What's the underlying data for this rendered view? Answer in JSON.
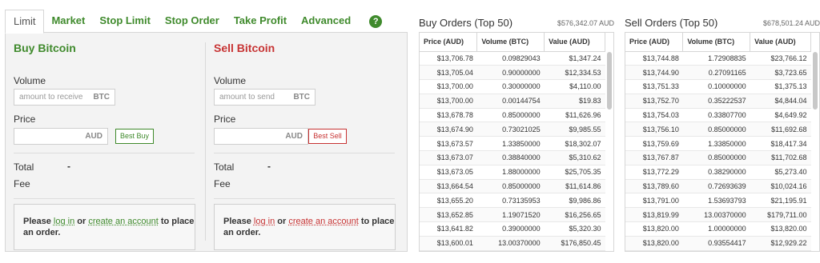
{
  "tabs": [
    "Limit",
    "Market",
    "Stop Limit",
    "Stop Order",
    "Take Profit",
    "Advanced"
  ],
  "help_icon": "question-circle-icon",
  "colors": {
    "buy": "#3f8a2c",
    "sell": "#c73333"
  },
  "buy": {
    "title": "Buy Bitcoin",
    "volume_label": "Volume",
    "volume_placeholder": "amount to receive",
    "volume_unit": "BTC",
    "price_label": "Price",
    "price_unit": "AUD",
    "best_button": "Best Buy",
    "total_label": "Total",
    "total_value": "-",
    "fee_label": "Fee",
    "login_prefix": "Please ",
    "login_link": "log in",
    "login_or": " or ",
    "create_link": "create an account",
    "login_suffix": " to place an order."
  },
  "sell": {
    "title": "Sell Bitcoin",
    "volume_label": "Volume",
    "volume_placeholder": "amount to send",
    "volume_unit": "BTC",
    "price_label": "Price",
    "price_unit": "AUD",
    "best_button": "Best Sell",
    "total_label": "Total",
    "total_value": "-",
    "fee_label": "Fee",
    "login_prefix": "Please ",
    "login_link": "log in",
    "login_or": " or ",
    "create_link": "create an account",
    "login_suffix": " to place an order."
  },
  "buy_orders": {
    "title": "Buy Orders (Top 50)",
    "total": "$576,342.07 AUD",
    "columns": [
      "Price (AUD)",
      "Volume (BTC)",
      "Value (AUD)"
    ],
    "rows": [
      [
        "$13,706.78",
        "0.09829043",
        "$1,347.24"
      ],
      [
        "$13,705.04",
        "0.90000000",
        "$12,334.53"
      ],
      [
        "$13,700.00",
        "0.30000000",
        "$4,110.00"
      ],
      [
        "$13,700.00",
        "0.00144754",
        "$19.83"
      ],
      [
        "$13,678.78",
        "0.85000000",
        "$11,626.96"
      ],
      [
        "$13,674.90",
        "0.73021025",
        "$9,985.55"
      ],
      [
        "$13,673.57",
        "1.33850000",
        "$18,302.07"
      ],
      [
        "$13,673.07",
        "0.38840000",
        "$5,310.62"
      ],
      [
        "$13,673.05",
        "1.88000000",
        "$25,705.35"
      ],
      [
        "$13,664.54",
        "0.85000000",
        "$11,614.86"
      ],
      [
        "$13,655.20",
        "0.73135953",
        "$9,986.86"
      ],
      [
        "$13,652.85",
        "1.19071520",
        "$16,256.65"
      ],
      [
        "$13,641.82",
        "0.39000000",
        "$5,320.30"
      ],
      [
        "$13,600.01",
        "13.00370000",
        "$176,850.45"
      ]
    ]
  },
  "sell_orders": {
    "title": "Sell Orders (Top 50)",
    "total": "$678,501.24 AUD",
    "columns": [
      "Price (AUD)",
      "Volume (BTC)",
      "Value (AUD)"
    ],
    "rows": [
      [
        "$13,744.88",
        "1.72908835",
        "$23,766.12"
      ],
      [
        "$13,744.90",
        "0.27091165",
        "$3,723.65"
      ],
      [
        "$13,751.33",
        "0.10000000",
        "$1,375.13"
      ],
      [
        "$13,752.70",
        "0.35222537",
        "$4,844.04"
      ],
      [
        "$13,754.03",
        "0.33807700",
        "$4,649.92"
      ],
      [
        "$13,756.10",
        "0.85000000",
        "$11,692.68"
      ],
      [
        "$13,759.69",
        "1.33850000",
        "$18,417.34"
      ],
      [
        "$13,767.87",
        "0.85000000",
        "$11,702.68"
      ],
      [
        "$13,772.29",
        "0.38290000",
        "$5,273.40"
      ],
      [
        "$13,789.60",
        "0.72693639",
        "$10,024.16"
      ],
      [
        "$13,791.00",
        "1.53693793",
        "$21,195.91"
      ],
      [
        "$13,819.99",
        "13.00370000",
        "$179,711.00"
      ],
      [
        "$13,820.00",
        "1.00000000",
        "$13,820.00"
      ],
      [
        "$13,820.00",
        "0.93554417",
        "$12,929.22"
      ]
    ]
  }
}
